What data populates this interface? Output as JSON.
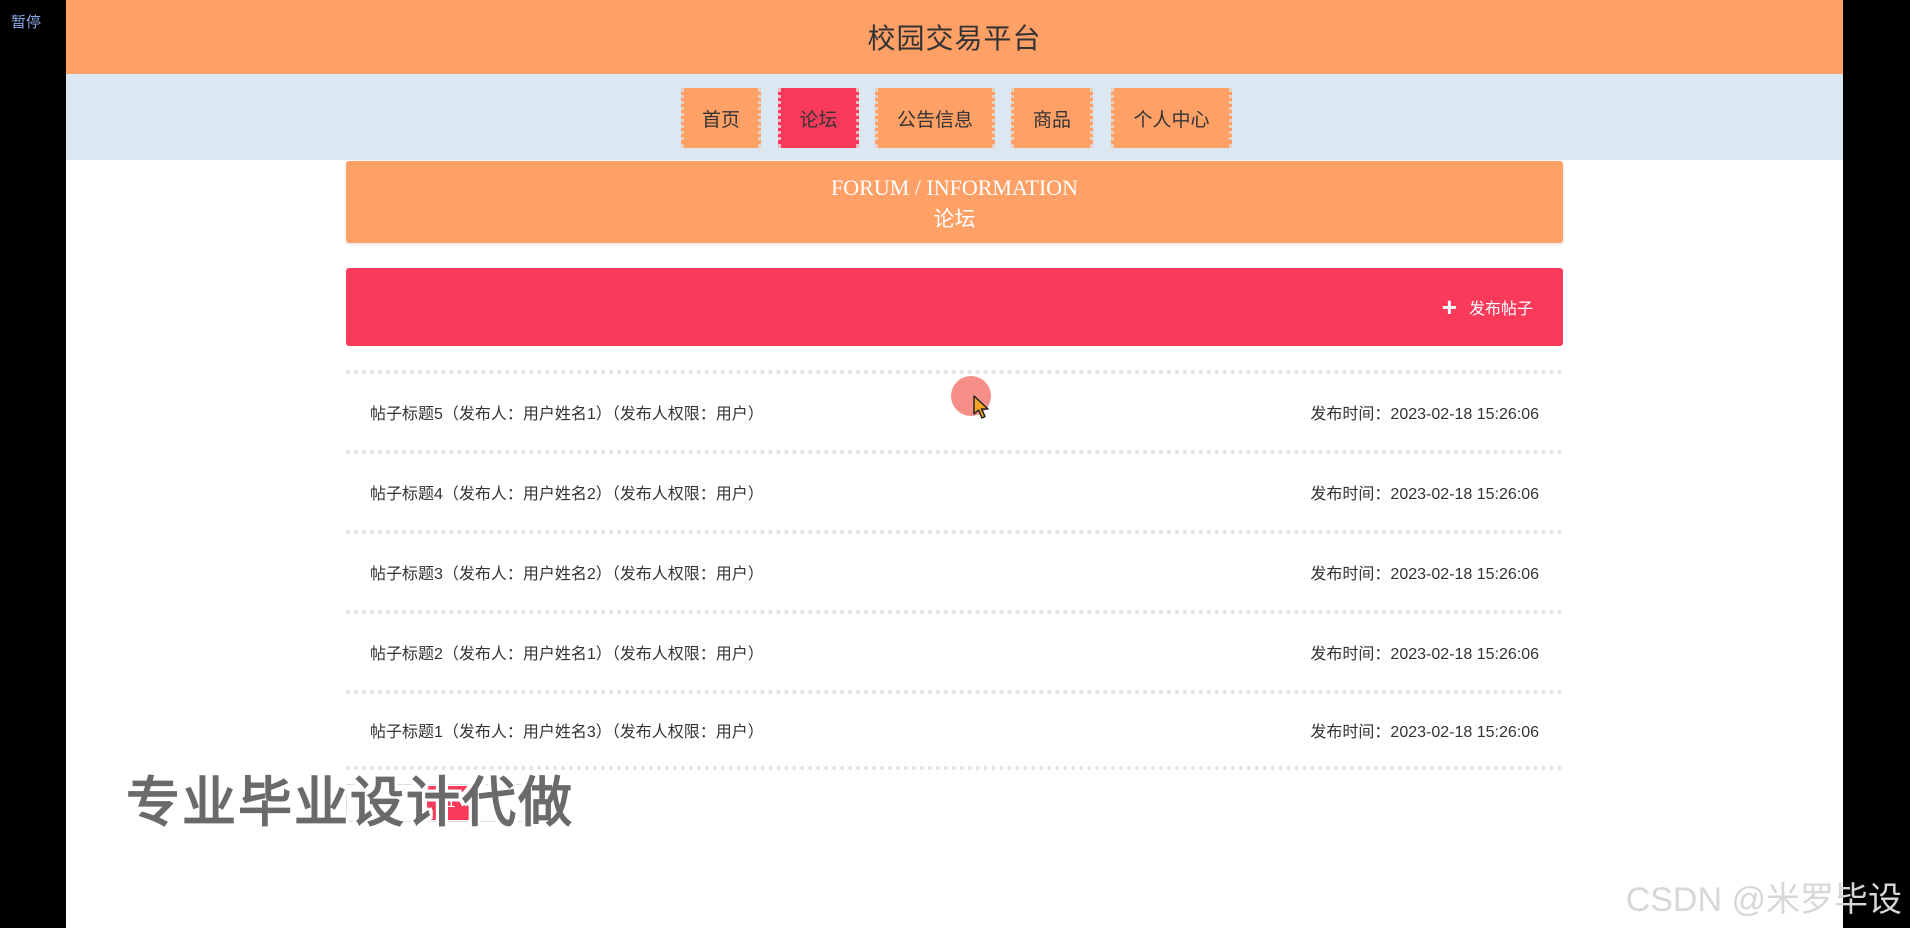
{
  "overlay": {
    "pause_label": "暂停"
  },
  "header": {
    "title": "校园交易平台"
  },
  "nav": {
    "items": [
      {
        "label": "首页",
        "active": false
      },
      {
        "label": "论坛",
        "active": true
      },
      {
        "label": "公告信息",
        "active": false
      },
      {
        "label": "商品",
        "active": false
      },
      {
        "label": "个人中心",
        "active": false
      }
    ]
  },
  "banner": {
    "title_en": "FORUM / INFORMATION",
    "title_cn": "论坛"
  },
  "actions": {
    "publish_label": "发布帖子",
    "publish_icon": "plus-icon"
  },
  "posts": [
    {
      "title": "帖子标题5（发布人：用户姓名1）（发布人权限：用户）",
      "time": "发布时间：2023-02-18 15:26:06"
    },
    {
      "title": "帖子标题4（发布人：用户姓名2）（发布人权限：用户）",
      "time": "发布时间：2023-02-18 15:26:06"
    },
    {
      "title": "帖子标题3（发布人：用户姓名2）（发布人权限：用户）",
      "time": "发布时间：2023-02-18 15:26:06"
    },
    {
      "title": "帖子标题2（发布人：用户姓名1）（发布人权限：用户）",
      "time": "发布时间：2023-02-18 15:26:06"
    },
    {
      "title": "帖子标题1（发布人：用户姓名3）（发布人权限：用户）",
      "time": "发布时间：2023-02-18 15:26:06"
    }
  ],
  "pagination": {
    "current_page": "1"
  },
  "watermarks": {
    "main": "专业毕业设计代做",
    "csdn": "CSDN @米罗毕设"
  },
  "colors": {
    "accent_orange": "#ffa067",
    "accent_red": "#f93a5b",
    "nav_bg": "#dce8f1"
  }
}
